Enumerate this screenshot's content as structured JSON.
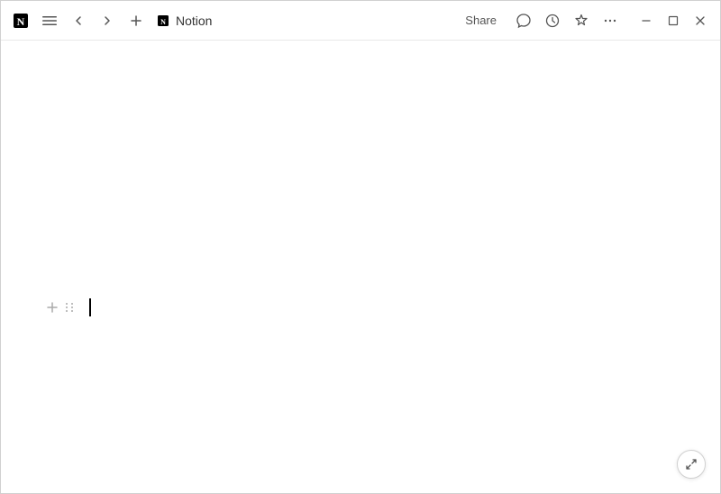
{
  "titlebar": {
    "page_name": "Notion",
    "share_label": "Share",
    "menu_icon": "≡",
    "back_icon": "‹",
    "forward_icon": "›",
    "add_icon": "+",
    "comment_icon": "💬",
    "history_icon": "🕐",
    "favorite_icon": "☆",
    "more_icon": "•••",
    "minimize_icon": "—",
    "maximize_icon": "□",
    "close_icon": "✕"
  },
  "editor": {
    "add_block_label": "+",
    "drag_handle_label": "⠿",
    "cursor_visible": true
  },
  "bottom_toolbar": {
    "expand_icon": "⤢"
  }
}
